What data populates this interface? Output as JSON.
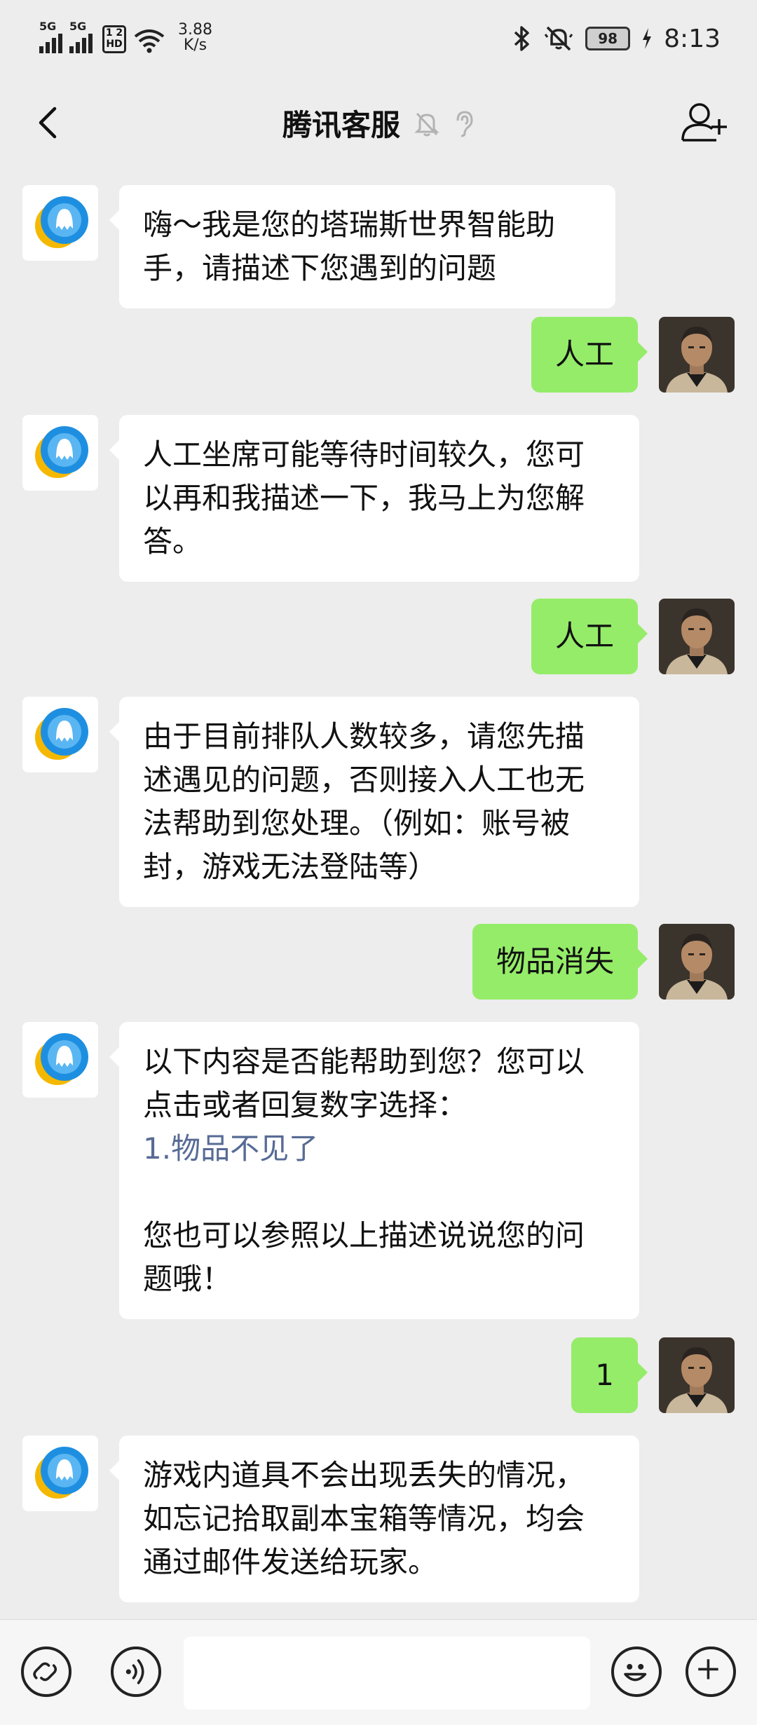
{
  "status_bar": {
    "signal1": "5G",
    "signal2": "5G",
    "hd_label": "1 2 HD",
    "speed_value": "3.88",
    "speed_unit": "K/s",
    "battery": "98",
    "time": "8:13"
  },
  "header": {
    "title": "腾讯客服"
  },
  "messages": [
    {
      "from": "bot",
      "lines": [
        "嗨～我是您的塔瑞斯世界智能助",
        "手，请描述下您遇到的问题"
      ]
    },
    {
      "from": "user",
      "text": "人工"
    },
    {
      "from": "bot",
      "lines": [
        "人工坐席可能等待时间较久，您可",
        "以再和我描述一下，我马上为您解",
        "答。"
      ]
    },
    {
      "from": "user",
      "text": "人工"
    },
    {
      "from": "bot",
      "lines": [
        "由于目前排队人数较多，请您先描",
        "述遇见的问题，否则接入人工也无",
        "法帮助到您处理。（例如：账号被",
        "封，游戏无法登陆等）"
      ]
    },
    {
      "from": "user",
      "text": "物品消失"
    },
    {
      "from": "bot",
      "lines": [
        "以下内容是否能帮助到您？您可以",
        "点击或者回复数字选择："
      ],
      "link": "1.物品不见了",
      "after": [
        "您也可以参照以上描述说说您的问",
        "题哦！"
      ]
    },
    {
      "from": "user",
      "text": "1"
    },
    {
      "from": "bot",
      "lines": [
        "游戏内道具不会出现丢失的情况，",
        "如忘记拾取副本宝箱等情况，均会",
        "通过邮件发送给玩家。"
      ]
    }
  ],
  "colors": {
    "background": "#ededed",
    "user_bubble": "#95ec69",
    "bot_bubble": "#ffffff",
    "link": "#576b95"
  },
  "icons": {
    "back": "chevron-left-icon",
    "mute": "bell-off-icon",
    "ear": "ear-icon",
    "add_user": "add-user-icon",
    "mini_program": "link-icon",
    "voice": "voice-icon",
    "emoji": "emoji-icon",
    "plus": "plus-icon"
  }
}
